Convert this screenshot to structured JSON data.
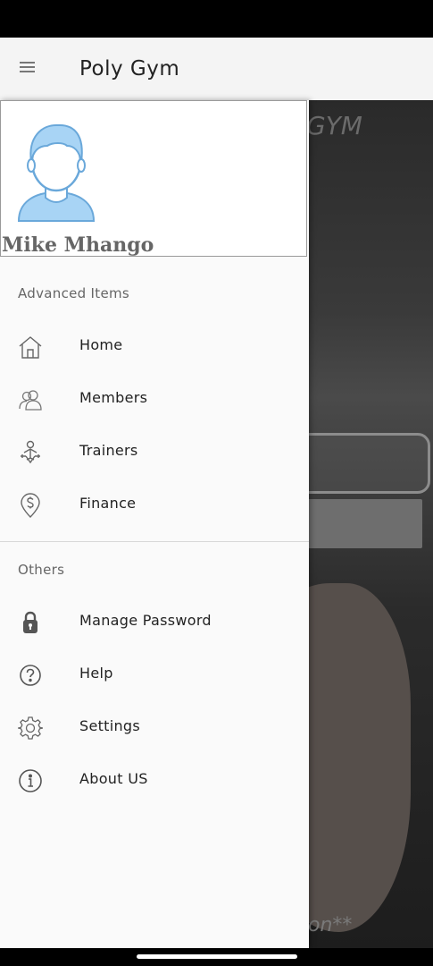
{
  "app_bar": {
    "menu_icon": "hamburger-menu-icon",
    "title": "Poly Gym"
  },
  "background": {
    "watermark_text": "GYM",
    "bottom_text": "on**"
  },
  "drawer": {
    "profile": {
      "avatar_icon": "user-avatar-icon",
      "name": "Mike Mhango"
    },
    "sections": [
      {
        "title": "Advanced Items",
        "items": [
          {
            "label": "Home",
            "icon": "home-icon"
          },
          {
            "label": "Members",
            "icon": "members-icon"
          },
          {
            "label": "Trainers",
            "icon": "trainer-icon"
          },
          {
            "label": "Finance",
            "icon": "finance-icon"
          }
        ]
      },
      {
        "title": "Others",
        "items": [
          {
            "label": "Manage Password",
            "icon": "lock-icon"
          },
          {
            "label": "Help",
            "icon": "help-icon"
          },
          {
            "label": "Settings",
            "icon": "gear-icon"
          },
          {
            "label": "About US",
            "icon": "info-icon"
          }
        ]
      }
    ]
  },
  "colors": {
    "app_bar_bg": "#f4f4f4",
    "drawer_bg": "#fafafa",
    "avatar_blue": "#a8d4f5",
    "icon_gray": "#666666"
  }
}
